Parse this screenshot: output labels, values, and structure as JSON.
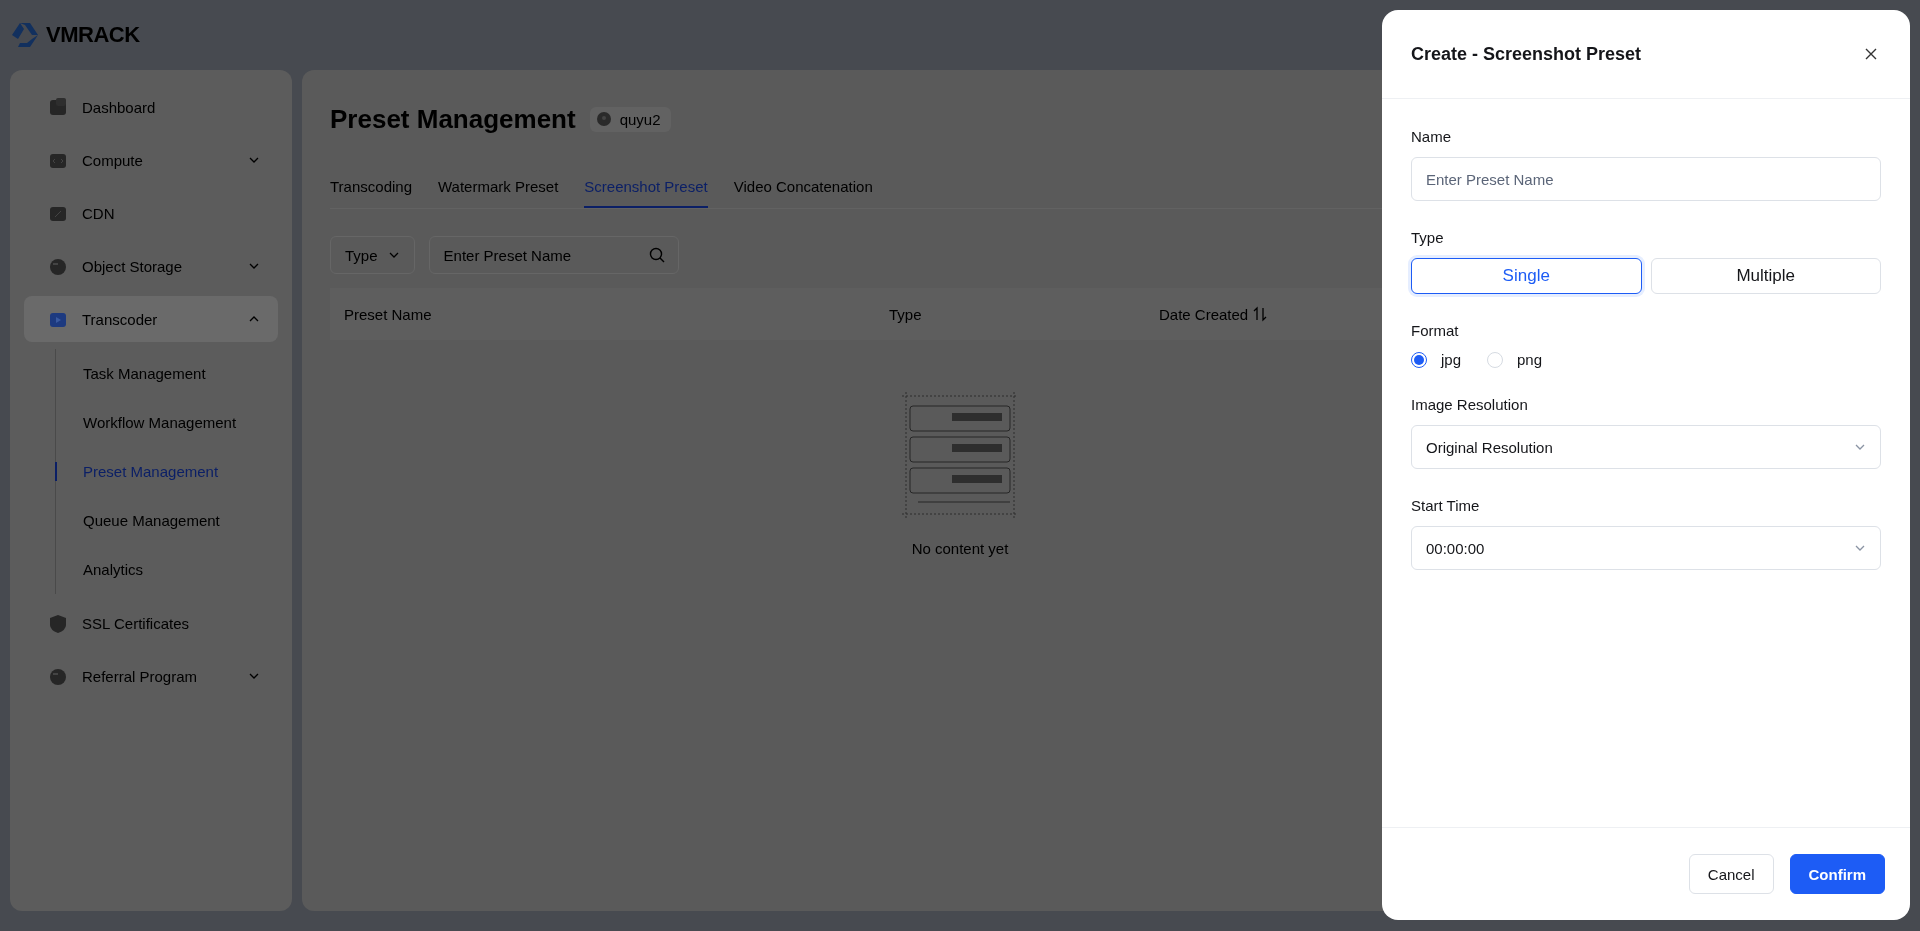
{
  "logo": {
    "text": "VMRACK"
  },
  "sidebar": {
    "items": [
      {
        "label": "Dashboard",
        "kind": "link",
        "selected": false
      },
      {
        "label": "Compute",
        "kind": "group",
        "expanded": false,
        "selected": false
      },
      {
        "label": "CDN",
        "kind": "link",
        "selected": false
      },
      {
        "label": "Object Storage",
        "kind": "group",
        "expanded": false,
        "selected": false
      },
      {
        "label": "Transcoder",
        "kind": "group",
        "expanded": true,
        "selected": true,
        "children": [
          {
            "label": "Task Management",
            "selected": false
          },
          {
            "label": "Workflow Management",
            "selected": false
          },
          {
            "label": "Preset Management",
            "selected": true
          },
          {
            "label": "Queue Management",
            "selected": false
          },
          {
            "label": "Analytics",
            "selected": false
          }
        ]
      },
      {
        "label": "SSL Certificates",
        "kind": "link",
        "selected": false
      },
      {
        "label": "Referral Program",
        "kind": "group",
        "expanded": false,
        "selected": false
      }
    ]
  },
  "page": {
    "title": "Preset Management",
    "region": "quyu2",
    "tabs": [
      {
        "label": "Transcoding",
        "selected": false
      },
      {
        "label": "Watermark Preset",
        "selected": false
      },
      {
        "label": "Screenshot Preset",
        "selected": true
      },
      {
        "label": "Video Concatenation",
        "selected": false
      }
    ],
    "filter": {
      "type_label": "Type",
      "search_placeholder": "Enter Preset Name"
    },
    "table": {
      "columns": [
        {
          "label": "Preset Name",
          "sortable": false
        },
        {
          "label": "Type",
          "sortable": false
        },
        {
          "label": "Date Created",
          "sortable": true
        }
      ],
      "empty_text": "No content yet"
    }
  },
  "drawer": {
    "title": "Create - Screenshot Preset",
    "fields": [
      {
        "kind": "input",
        "label": "Name",
        "placeholder": "Enter Preset Name"
      },
      {
        "kind": "segmented",
        "label": "Type",
        "options": [
          {
            "label": "Single",
            "selected": true
          },
          {
            "label": "Multiple",
            "selected": false
          }
        ]
      },
      {
        "kind": "radio",
        "label": "Format",
        "options": [
          {
            "label": "jpg",
            "selected": true
          },
          {
            "label": "png",
            "selected": false
          }
        ]
      },
      {
        "kind": "select",
        "label": "Image Resolution",
        "value": "Original Resolution"
      },
      {
        "kind": "select",
        "label": "Start Time",
        "value": "00:00:00"
      }
    ],
    "buttons": [
      {
        "label": "Cancel",
        "kind": "secondary"
      },
      {
        "label": "Confirm",
        "kind": "primary"
      }
    ]
  }
}
